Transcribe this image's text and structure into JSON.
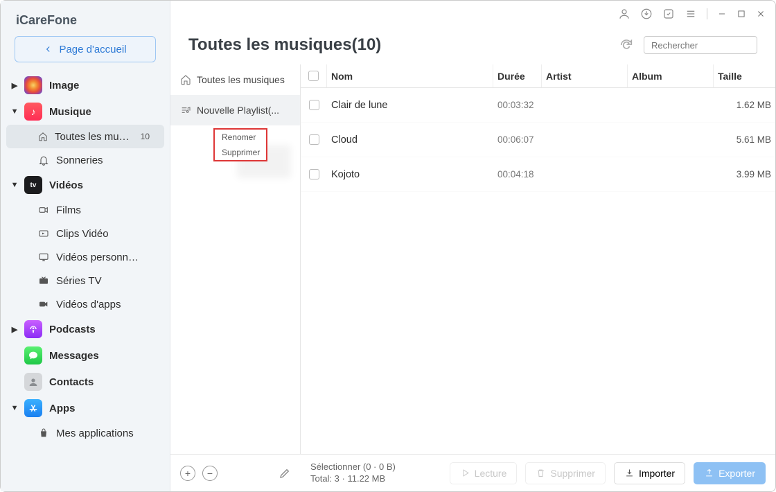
{
  "app": {
    "title": "iCareFone"
  },
  "home_button": "Page d'accueil",
  "sidebar": {
    "image": {
      "label": "Image"
    },
    "musique": {
      "label": "Musique",
      "children": [
        {
          "label": "Toutes les musiq...",
          "badge": "10"
        },
        {
          "label": "Sonneries"
        }
      ]
    },
    "videos": {
      "label": "Vidéos",
      "children": [
        {
          "label": "Films"
        },
        {
          "label": "Clips Vidéo"
        },
        {
          "label": "Vidéos personnell..."
        },
        {
          "label": "Séries TV"
        },
        {
          "label": "Vidéos d'apps"
        }
      ]
    },
    "podcasts": {
      "label": "Podcasts"
    },
    "messages": {
      "label": "Messages"
    },
    "contacts": {
      "label": "Contacts"
    },
    "apps": {
      "label": "Apps",
      "children": [
        {
          "label": "Mes applications"
        }
      ]
    }
  },
  "header": {
    "title": "Toutes les musiques(10)",
    "search_placeholder": "Rechercher"
  },
  "playlist_panel": {
    "all": "Toutes les musiques",
    "new": "Nouvelle Playlist(..."
  },
  "context_menu": {
    "rename": "Renomer",
    "delete": "Supprimer"
  },
  "columns": {
    "nom": "Nom",
    "duree": "Durée",
    "artist": "Artist",
    "album": "Album",
    "taille": "Taille"
  },
  "rows": [
    {
      "nom": "Clair de lune",
      "duree": "00:03:32",
      "artist": "",
      "album": "",
      "taille": "1.62 MB"
    },
    {
      "nom": "Cloud",
      "duree": "00:06:07",
      "artist": "",
      "album": "",
      "taille": "5.61 MB"
    },
    {
      "nom": "Kojoto",
      "duree": "00:04:18",
      "artist": "",
      "album": "",
      "taille": "3.99 MB"
    }
  ],
  "footer": {
    "selection": "Sélectionner (0 · 0 B)",
    "total": "Total: 3 · 11.22 MB",
    "lecture": "Lecture",
    "supprimer": "Supprimer",
    "importer": "Importer",
    "exporter": "Exporter"
  }
}
